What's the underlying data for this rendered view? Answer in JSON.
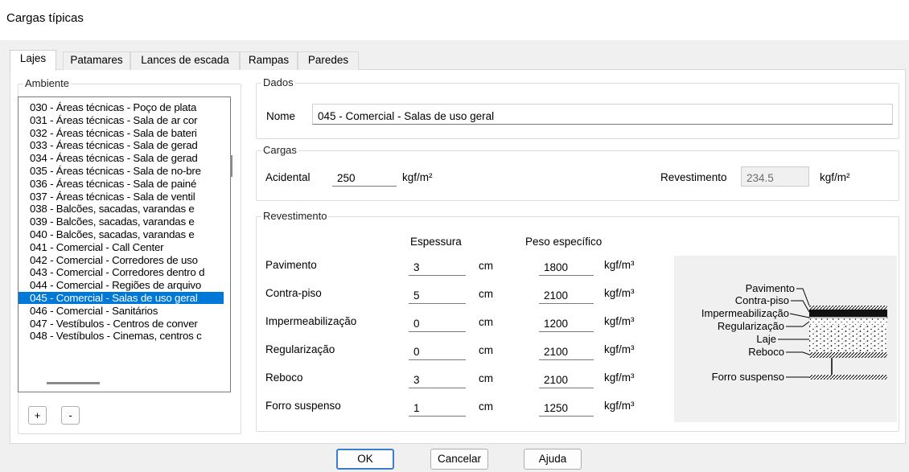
{
  "window": {
    "title": "Cargas típicas"
  },
  "tabs": [
    "Lajes",
    "Patamares",
    "Lances de escada",
    "Rampas",
    "Paredes"
  ],
  "ambiente": {
    "legend": "Ambiente",
    "items": [
      "030 - Áreas técnicas - Poço de plata",
      "031 - Áreas técnicas - Sala de ar cor",
      "032 - Áreas técnicas - Sala de bateri",
      "033 - Áreas técnicas - Sala de gerad",
      "034 - Áreas técnicas - Sala de gerad",
      "035 - Áreas técnicas - Sala de no-bre",
      "036 - Áreas técnicas - Sala de painé",
      "037 - Áreas técnicas - Sala de ventil",
      "038 - Balcões, sacadas, varandas e",
      "039 - Balcões, sacadas, varandas e",
      "040 - Balcões, sacadas, varandas e",
      "041 - Comercial - Call Center",
      "042 - Comercial - Corredores de uso",
      "043 - Comercial - Corredores dentro d",
      "044 - Comercial - Regiões de arquivo",
      "045 - Comercial - Salas de uso geral",
      "046 - Comercial - Sanitários",
      "047 - Vestíbulos - Centros de conver",
      "048 - Vestíbulos - Cinemas, centros c"
    ],
    "selected_index": 15,
    "add_label": "+",
    "remove_label": "-"
  },
  "dados": {
    "legend": "Dados",
    "nome_label": "Nome",
    "nome_value": "045 - Comercial - Salas de uso geral"
  },
  "cargas": {
    "legend": "Cargas",
    "acidental_label": "Acidental",
    "acidental_value": "250",
    "acidental_unit": "kgf/m²",
    "revestimento_label": "Revestimento",
    "revestimento_value": "234.5",
    "revestimento_unit": "kgf/m²"
  },
  "revestimento": {
    "legend": "Revestimento",
    "col_espessura": "Espessura",
    "col_peso": "Peso específico",
    "rows": [
      {
        "label": "Pavimento",
        "espessura": "3",
        "esp_unit": "cm",
        "peso": "1800",
        "peso_unit": "kgf/m³"
      },
      {
        "label": "Contra-piso",
        "espessura": "5",
        "esp_unit": "cm",
        "peso": "2100",
        "peso_unit": "kgf/m³"
      },
      {
        "label": "Impermeabilização",
        "espessura": "0",
        "esp_unit": "cm",
        "peso": "1200",
        "peso_unit": "kgf/m³"
      },
      {
        "label": "Regularização",
        "espessura": "0",
        "esp_unit": "cm",
        "peso": "2100",
        "peso_unit": "kgf/m³"
      },
      {
        "label": "Reboco",
        "espessura": "3",
        "esp_unit": "cm",
        "peso": "2100",
        "peso_unit": "kgf/m³"
      },
      {
        "label": "Forro suspenso",
        "espessura": "1",
        "esp_unit": "cm",
        "peso": "1250",
        "peso_unit": "kgf/m³"
      }
    ],
    "diagram_labels": [
      "Pavimento",
      "Contra-piso",
      "Impermeabilização",
      "Regularização",
      "Laje",
      "Reboco",
      "Forro suspenso"
    ]
  },
  "buttons": {
    "ok": "OK",
    "cancel": "Cancelar",
    "help": "Ajuda"
  }
}
